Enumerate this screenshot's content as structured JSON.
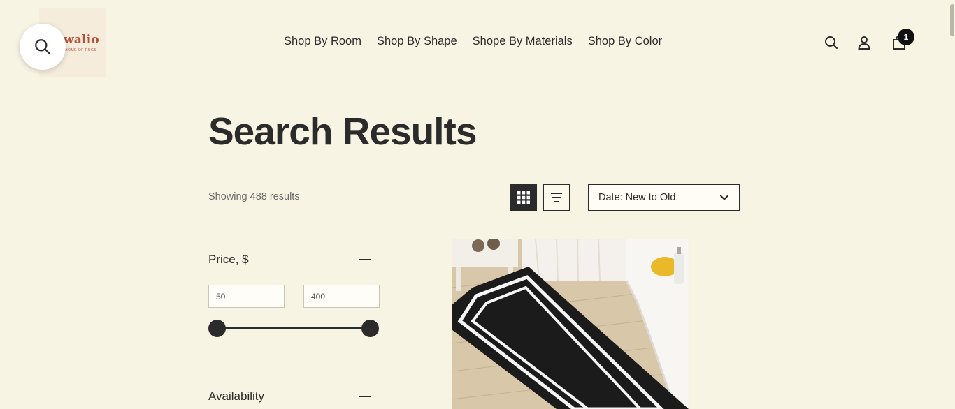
{
  "brand": {
    "name": "walio",
    "tagline": "HOME OF RUGS"
  },
  "nav": {
    "items": [
      {
        "label": "Shop By Room"
      },
      {
        "label": "Shop By Shape"
      },
      {
        "label": "Shope By Materials"
      },
      {
        "label": "Shop By Color"
      }
    ]
  },
  "header": {
    "cart_count": "1",
    "icons": [
      "search-icon",
      "account-icon",
      "cart-icon"
    ]
  },
  "page": {
    "title": "Search Results",
    "results_text": "Showing 488 results"
  },
  "toolbar": {
    "sort_selected": "Date: New to Old",
    "view_modes": [
      "grid",
      "list"
    ]
  },
  "filters": {
    "price": {
      "label": "Price, $",
      "min_value": "50",
      "max_value": "400",
      "range": [
        50,
        400
      ]
    },
    "availability": {
      "label": "Availability"
    }
  },
  "colors": {
    "background": "#f8f4e3",
    "text": "#2b2b2b",
    "brand": "#b5513a"
  }
}
